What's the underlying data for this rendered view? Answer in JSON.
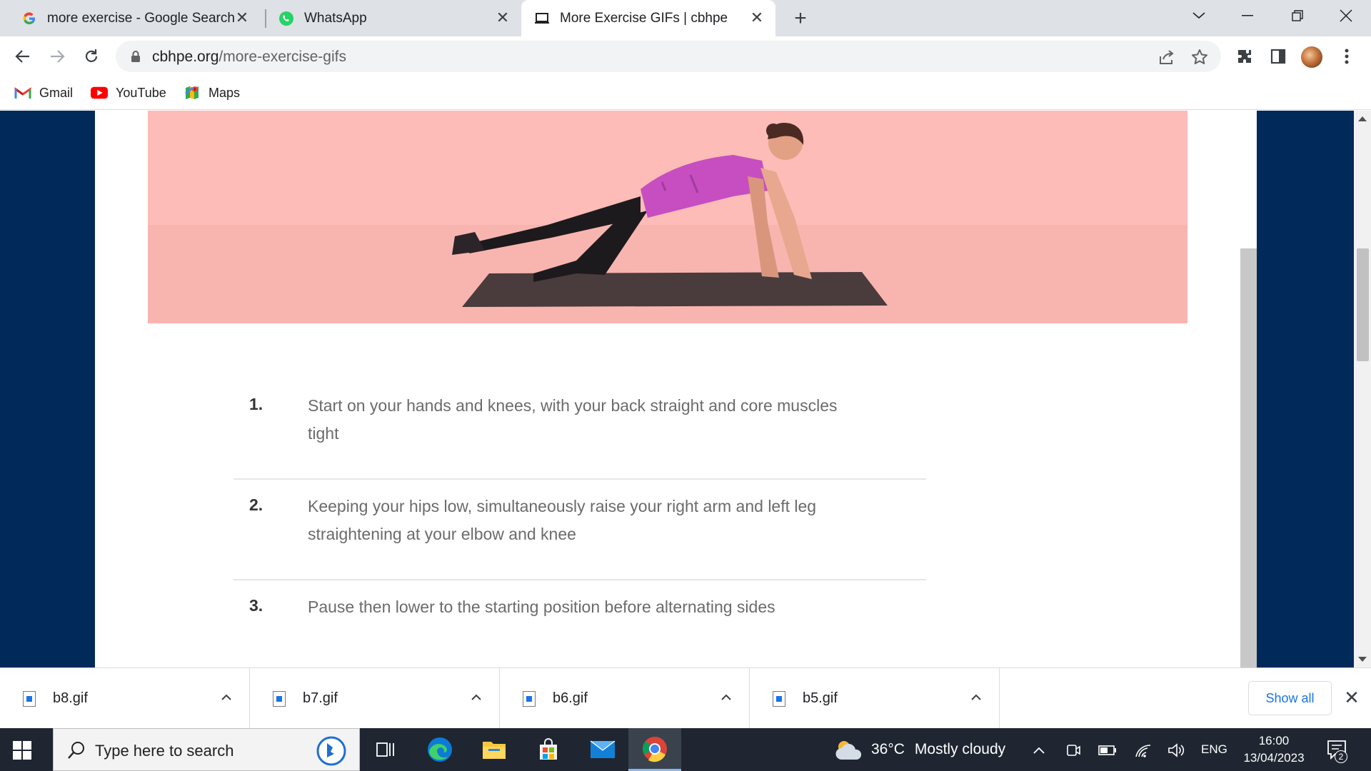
{
  "browser": {
    "tabs": [
      {
        "title": "more exercise - Google Search",
        "icon": "google-icon"
      },
      {
        "title": "WhatsApp",
        "icon": "whatsapp-icon"
      },
      {
        "title": "More Exercise GIFs | cbhpe",
        "icon": "site-favicon-icon",
        "active": true
      }
    ],
    "url_domain": "cbhpe.org",
    "url_path": "/more-exercise-gifs",
    "bookmarks": [
      {
        "label": "Gmail",
        "icon": "gmail-icon"
      },
      {
        "label": "YouTube",
        "icon": "youtube-icon"
      },
      {
        "label": "Maps",
        "icon": "maps-icon"
      }
    ]
  },
  "page": {
    "steps": [
      {
        "number": "1.",
        "text": "Start on your hands and knees, with your back straight and core muscles tight"
      },
      {
        "number": "2.",
        "text": "Keeping your hips low, simultaneously raise your right arm and left leg straightening at your elbow and knee"
      },
      {
        "number": "3.",
        "text": "Pause then lower to the starting position before alternating sides"
      }
    ]
  },
  "downloads": {
    "items": [
      {
        "name": "b8.gif"
      },
      {
        "name": "b7.gif"
      },
      {
        "name": "b6.gif"
      },
      {
        "name": "b5.gif"
      }
    ],
    "show_all_label": "Show all"
  },
  "taskbar": {
    "search_placeholder": "Type here to search",
    "weather_temp": "36°C",
    "weather_text": "Mostly cloudy",
    "language": "ENG",
    "time": "16:00",
    "date": "13/04/2023",
    "notification_count": "2"
  },
  "colors": {
    "page_background": "#012a5a",
    "hero_background": "#fdbcb7",
    "accent": "#1a73e8"
  }
}
